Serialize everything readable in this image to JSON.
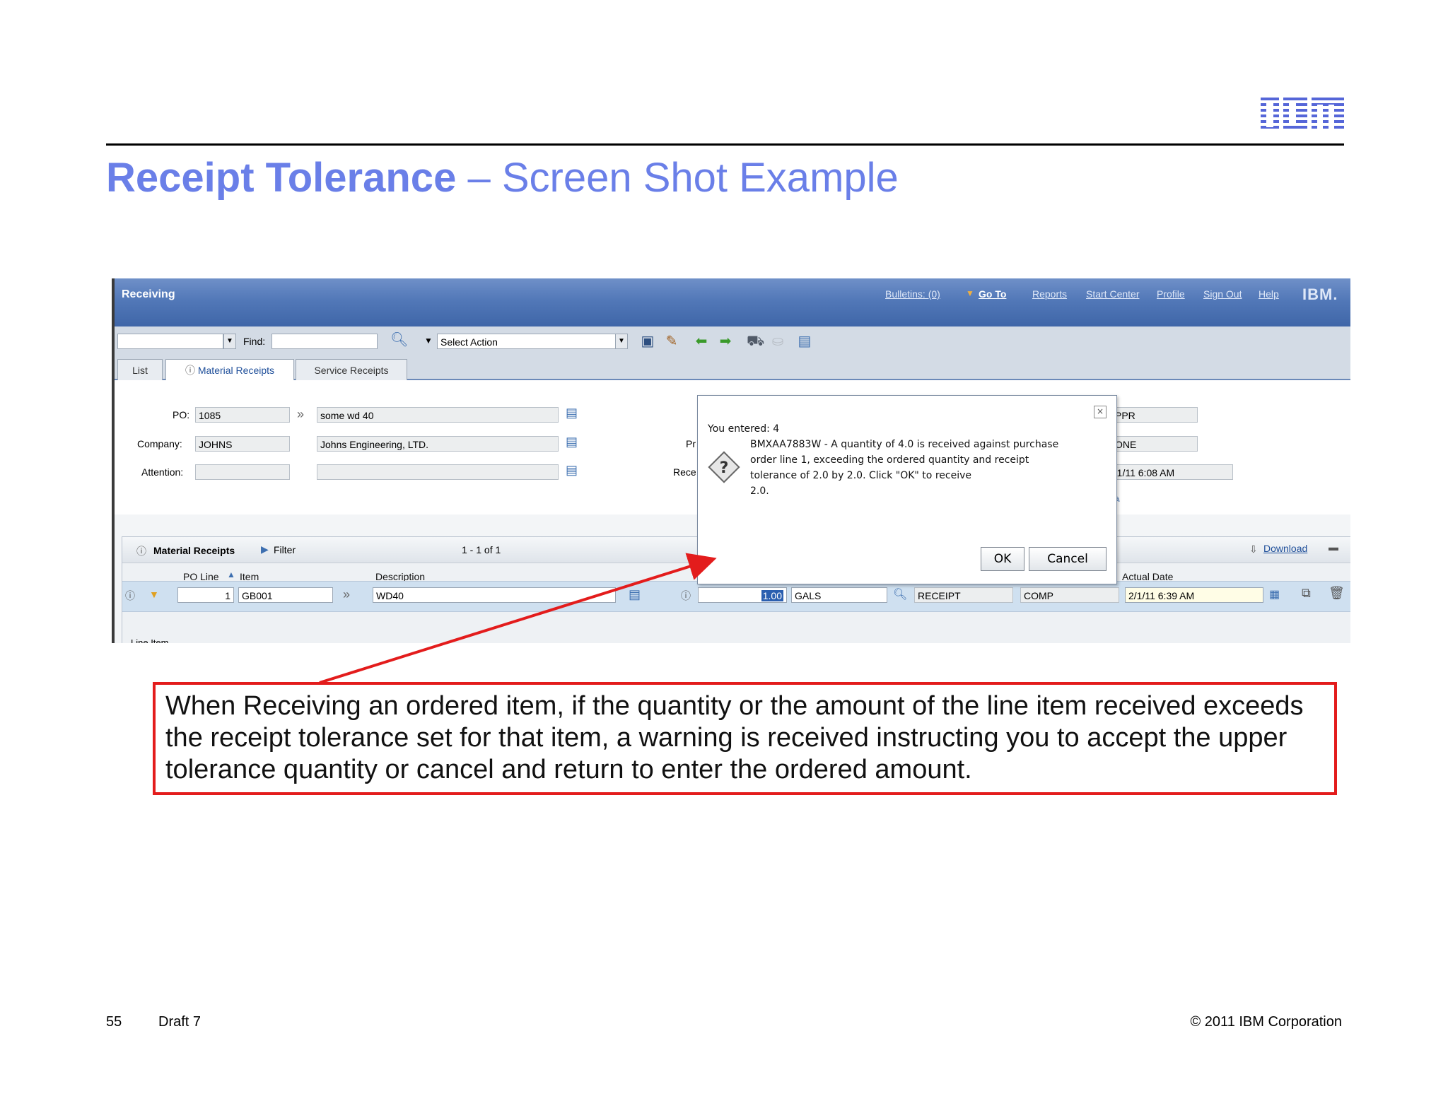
{
  "slide": {
    "title_bold": "Receipt Tolerance",
    "title_rest": " – Screen Shot Example",
    "logo_text": "IBM",
    "page_number": "55",
    "draft": "Draft 7",
    "copyright": "© 2011 IBM Corporation"
  },
  "app": {
    "title": "Receiving",
    "links": [
      "Bulletins: (0)",
      "Go To",
      "Reports",
      "Start Center",
      "Profile",
      "Sign Out",
      "Help"
    ],
    "logo_text": "IBM."
  },
  "toolbar": {
    "find_label": "Find:",
    "select_action": "Select Action"
  },
  "tabs": [
    "List",
    "Material Receipts",
    "Service Receipts"
  ],
  "form": {
    "po_label": "PO:",
    "po_value": "1085",
    "po_desc": "some wd 40",
    "company_label": "Company:",
    "company_value": "JOHNS",
    "company_desc": "Johns Engineering, LTD.",
    "attention_label": "Attention:",
    "partial_label_1": "Pr",
    "partial_label_2": "Rece",
    "right_val_1": "PPR",
    "right_val_2": "ONE",
    "right_val_3": "'1/11 6:08 AM"
  },
  "receipts_table": {
    "title": "Material Receipts",
    "filter": "Filter",
    "paging": "1 - 1 of 1",
    "download": "Download",
    "columns": [
      "PO Line",
      "Item",
      "Description",
      "Actual Date"
    ],
    "row": {
      "po_line": "1",
      "item": "GB001",
      "description": "WD40",
      "quantity": "1.00",
      "unit": "GALS",
      "status": "RECEIPT",
      "inspection": "COMP",
      "actual_date": "2/1/11 6:39 AM"
    },
    "footer_label": "Line Item"
  },
  "dialog": {
    "entered": "You entered: 4",
    "message_lines": [
      "BMXAA7883W - A quantity of 4.0 is received against purchase",
      "order line 1, exceeding the ordered quantity and receipt",
      "tolerance of 2.0 by 2.0. Click \"OK\" to receive",
      "2.0."
    ],
    "ok_label": "OK",
    "cancel_label": "Cancel"
  },
  "annotation": {
    "text": "When Receiving an ordered item, if the quantity or the amount of the line item received exceeds the receipt tolerance set for that item, a warning is received instructing you to accept the upper tolerance quantity or cancel and return to enter the ordered amount.",
    "color": "#e31c1c"
  },
  "colors": {
    "title": "#6a7fe8",
    "header_bar": "#5278b8",
    "link": "#1f4f9a"
  }
}
